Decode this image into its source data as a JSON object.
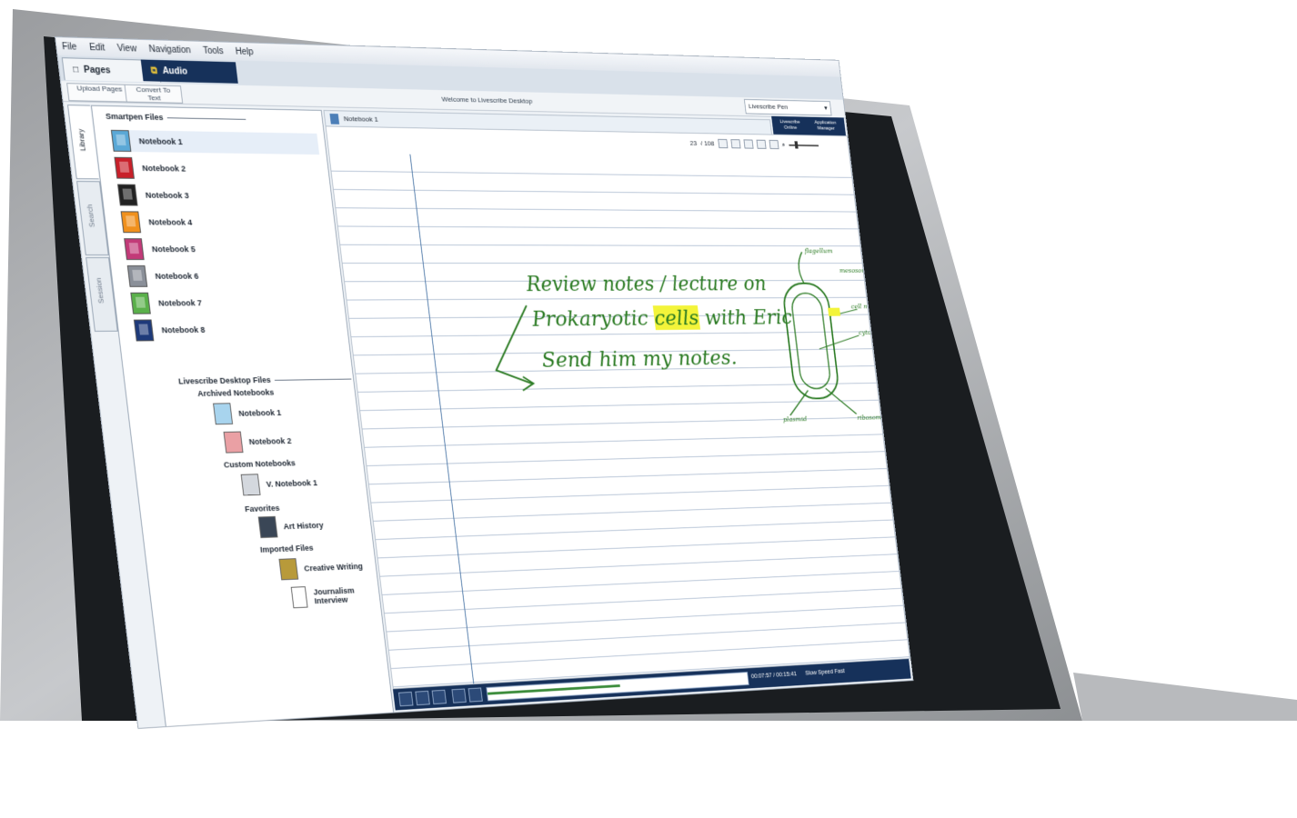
{
  "menu": [
    "File",
    "Edit",
    "View",
    "Navigation",
    "Tools",
    "Help"
  ],
  "tabs": {
    "pages": "Pages",
    "audio": "Audio"
  },
  "toolbar": {
    "upload": "Upload Pages",
    "convert": "Convert To Text"
  },
  "welcome": "Welcome to Livescribe Desktop",
  "user_select": "Livescribe Pen",
  "right_buttons": {
    "online": "Livescribe Online",
    "app_manager": "Application Manager"
  },
  "vertical_tabs": [
    "Library",
    "Search",
    "Session"
  ],
  "smartpen": {
    "header": "Smartpen Files",
    "notebooks": [
      {
        "label": "Notebook 1",
        "color": "#5aa8d6"
      },
      {
        "label": "Notebook 2",
        "color": "#c8202a"
      },
      {
        "label": "Notebook 3",
        "color": "#222222"
      },
      {
        "label": "Notebook 4",
        "color": "#f0901c"
      },
      {
        "label": "Notebook 5",
        "color": "#c23a78"
      },
      {
        "label": "Notebook 6",
        "color": "#8a8f98"
      },
      {
        "label": "Notebook 7",
        "color": "#5ab04a"
      },
      {
        "label": "Notebook 8",
        "color": "#1e3a7a"
      }
    ]
  },
  "desktop": {
    "header": "Livescribe Desktop Files",
    "archived_header": "Archived Notebooks",
    "archived": [
      "Notebook 1",
      "Notebook 2"
    ],
    "custom_header": "Custom Notebooks",
    "custom": [
      "V. Notebook 1"
    ],
    "favorites_header": "Favorites",
    "favorites": [
      "Art History"
    ],
    "imported_header": "Imported Files",
    "imported": [
      "Creative Writing",
      "Journalism Interview"
    ]
  },
  "notebook_title": "Notebook 1",
  "pager": {
    "current": "23",
    "total": "/ 108"
  },
  "handwriting": {
    "line1": "Review notes / lecture on",
    "line2_pre": "Prokaryotic ",
    "line2_hl": "cells",
    "line2_post": " with Eric",
    "line3": "Send him my notes."
  },
  "diagram_labels": [
    "flagellum",
    "mesosome",
    "cell membrane",
    "cytoplasm",
    "plasmid",
    "ribosome"
  ],
  "playback": {
    "time": "00:07:57 / 00:15:41",
    "speed": "Slow Speed Fast",
    "progress": 0.5
  }
}
